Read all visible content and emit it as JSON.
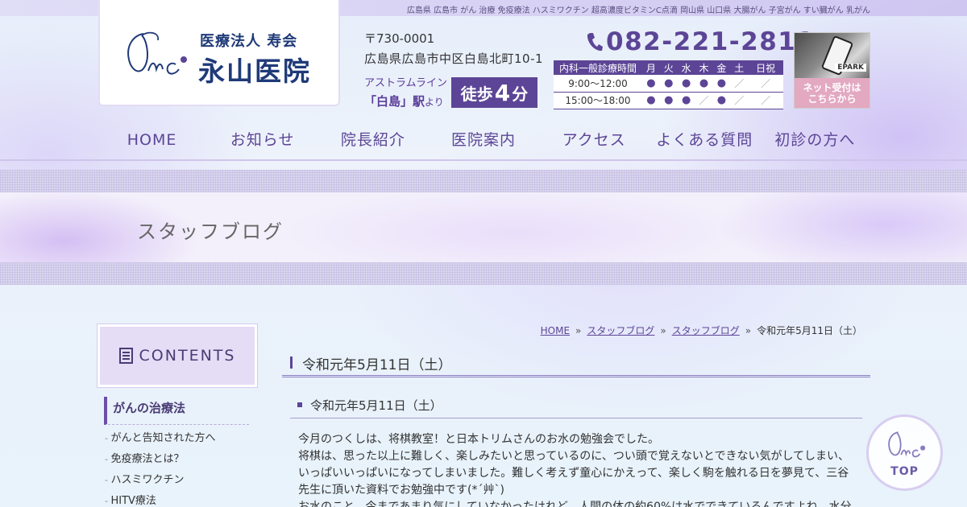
{
  "seo_keywords": "広島県 広島市 がん 治療 免疫療法 ハスミワクチン 超高濃度ビタミンC点滴 岡山県 山口県 大腸がん 子宮がん すい臓がん 乳がん",
  "logo": {
    "corp": "医療法人 寿会",
    "name": "永山医院"
  },
  "address": {
    "zip": "〒730-0001",
    "line": "広島県広島市中区白島北町10-1"
  },
  "access": {
    "line": "アストラムライン",
    "station": "「白島」駅",
    "suffix": "より",
    "walk_text": "徒歩",
    "walk_minutes": "4",
    "walk_unit": "分"
  },
  "phone": "082-221-2811",
  "hours": {
    "header": [
      "内科一般診療時間",
      "月",
      "火",
      "水",
      "木",
      "金",
      "土",
      "日祝"
    ],
    "rows": [
      {
        "time": "9:00～12:00",
        "cells": [
          "●",
          "●",
          "●",
          "●",
          "●",
          "／",
          "／"
        ]
      },
      {
        "time": "15:00～18:00",
        "cells": [
          "●",
          "●",
          "●",
          "／",
          "●",
          "／",
          "／"
        ]
      }
    ]
  },
  "epark": {
    "brand": "EPARK",
    "cta_line1": "ネット受付は",
    "cta_line2": "こちらから"
  },
  "nav": [
    "HOME",
    "お知らせ",
    "院長紹介",
    "医院案内",
    "アクセス",
    "よくある質問",
    "初診の方へ"
  ],
  "page_title": "スタッフブログ",
  "sidebar": {
    "contents_label": "CONTENTS",
    "heading": "がんの治療法",
    "items": [
      "がんと告知された方へ",
      "免疫療法とは？",
      "ハスミワクチン",
      "HITV療法"
    ]
  },
  "breadcrumb": {
    "items": [
      "HOME",
      "スタッフブログ",
      "スタッフブログ"
    ],
    "current": "令和元年5月11日（土）",
    "separator": "»"
  },
  "article": {
    "title": "令和元年5月11日（土）",
    "post_title": "令和元年5月11日（土）",
    "body": [
      "今月のつくしは、将棋教室！と日本トリムさんのお水の勉強会でした。",
      "将棋は、思った以上に難しく、楽しみたいと思っているのに、つい頭で覚えないとできない気がしてしまい、",
      "いっぱいいっぱいになってしまいました。難しく考えず童心にかえって、楽しく駒を触れる日を夢見て、三谷",
      "先生に頂いた資料でお勉強中です(*´艸`)",
      "お水のこと、今まであまり気にしていなかったけれど、人間の体の約60%は水でできているんですよね。水分"
    ]
  },
  "to_top": "TOP",
  "colors": {
    "brand_purple": "#5c4596",
    "logo_navy": "#1f3a78",
    "epark_pink": "#e3a9c0"
  }
}
